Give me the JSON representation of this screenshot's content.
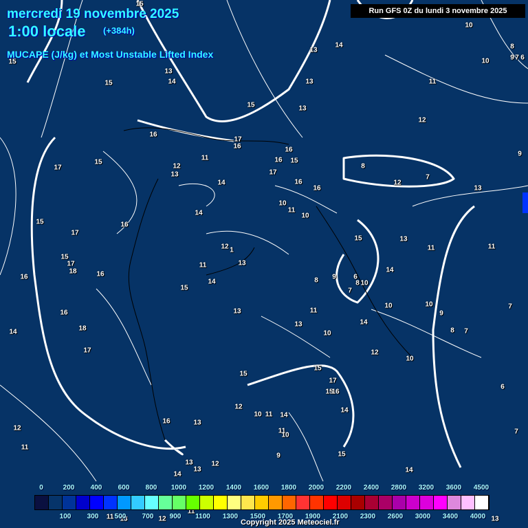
{
  "header": {
    "date": "mercredi 19 novembre 2025",
    "time": "1:00 locale",
    "lead": "(+384h)",
    "parameter": "MUCAPE (J/kg) et Most Unstable Lifted Index",
    "run": "Run GFS 0Z du lundi 3 novembre 2025"
  },
  "colorbar": {
    "top_labels": [
      "0",
      "200",
      "400",
      "600",
      "800",
      "1000",
      "1200",
      "1400",
      "1600",
      "1800",
      "2000",
      "2200",
      "2400",
      "2800",
      "3200",
      "3600",
      "4500"
    ],
    "bottom_labels": [
      "100",
      "300",
      "500",
      "700",
      "900",
      "1100",
      "1300",
      "1500",
      "1700",
      "1900",
      "2100",
      "2300",
      "2600",
      "3000",
      "3400",
      "4000"
    ],
    "colors": [
      "#0a1040",
      "#06346a",
      "#003399",
      "#0000cc",
      "#0000ff",
      "#0033ff",
      "#0099ff",
      "#33ccff",
      "#66ffff",
      "#66ff99",
      "#66ff66",
      "#66ff00",
      "#ccff00",
      "#ffff00",
      "#ffff80",
      "#ffe64d",
      "#ffcc00",
      "#ff9900",
      "#ff6600",
      "#ff3333",
      "#ff3300",
      "#ff0000",
      "#dd0000",
      "#aa0000",
      "#aa0033",
      "#aa0066",
      "#aa00aa",
      "#cc00cc",
      "#dd00dd",
      "#ff00ff",
      "#dd88dd",
      "#ffc0ff",
      "#ffffff"
    ]
  },
  "contour_labels": [
    "15",
    "15",
    "13",
    "14",
    "15",
    "13",
    "14",
    "13",
    "13",
    "15",
    "11",
    "12",
    "10",
    "10",
    "8",
    "9",
    "7",
    "6",
    "9",
    "16",
    "17",
    "16",
    "16",
    "16",
    "15",
    "11",
    "15",
    "17",
    "12",
    "13",
    "14",
    "17",
    "16",
    "16",
    "8",
    "7",
    "12",
    "13",
    "10",
    "11",
    "10",
    "14",
    "16",
    "17",
    "15",
    "15",
    "13",
    "11",
    "11",
    "12",
    "1",
    "13",
    "11",
    "15",
    "17",
    "18",
    "16",
    "16",
    "14",
    "15",
    "8",
    "9",
    "6",
    "8",
    "10",
    "7",
    "14",
    "10",
    "10",
    "9",
    "7",
    "13",
    "13",
    "11",
    "10",
    "14",
    "8",
    "7",
    "16",
    "18",
    "14",
    "17",
    "12",
    "10",
    "15",
    "17",
    "15",
    "15",
    "16",
    "6",
    "14",
    "12",
    "10",
    "11",
    "14",
    "16",
    "13",
    "12",
    "11",
    "11",
    "10",
    "9",
    "15",
    "7",
    "13",
    "13",
    "12",
    "14",
    "14",
    "13",
    "11",
    "12",
    "11",
    "13"
  ],
  "copyright": "Copyright 2025 Meteociel.fr"
}
